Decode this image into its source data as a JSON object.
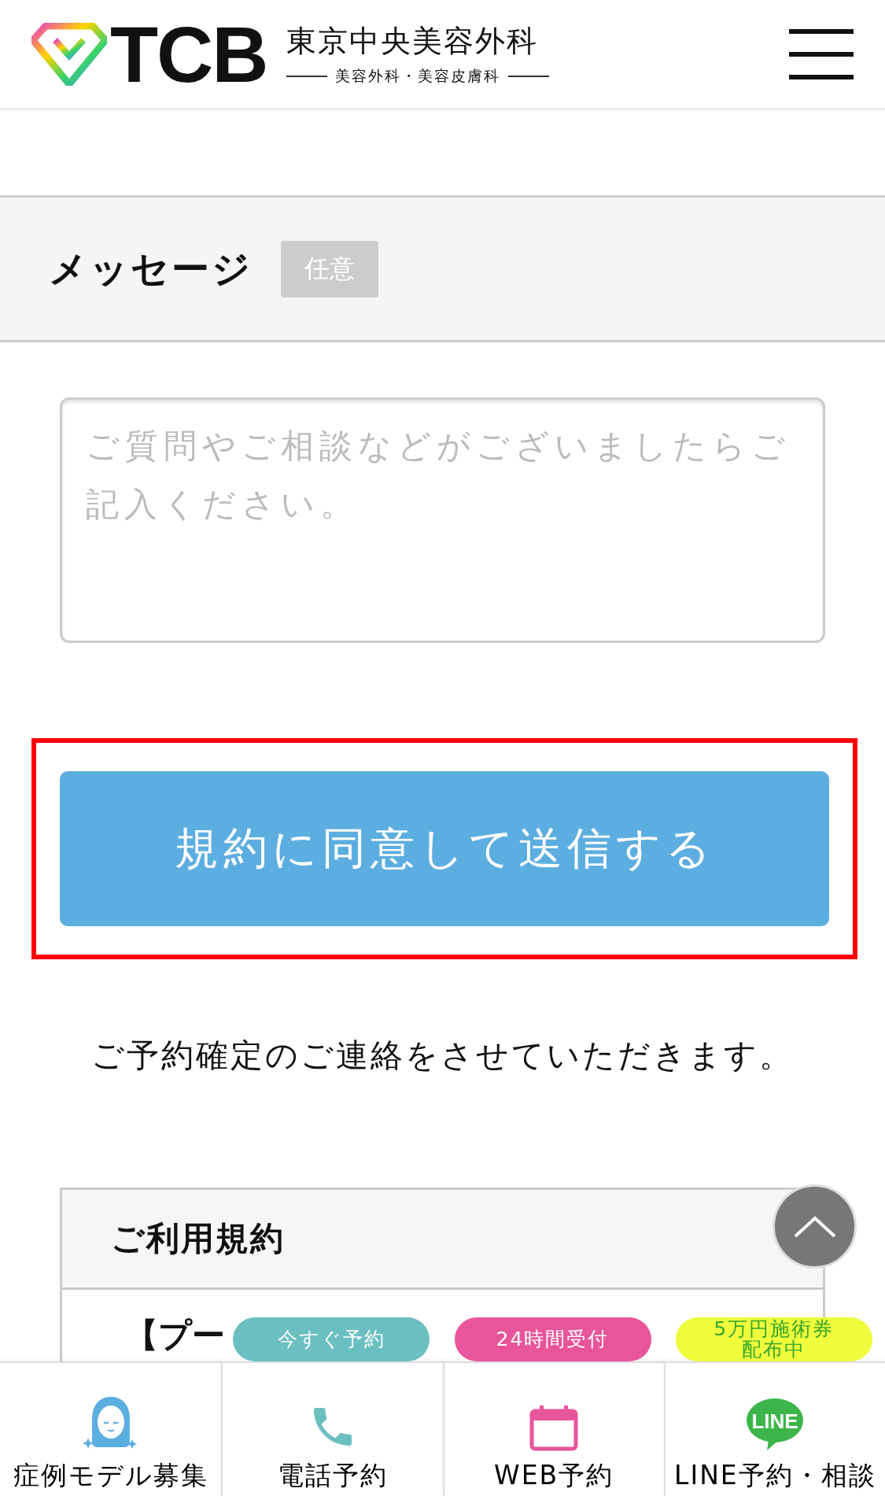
{
  "header": {
    "logo_text": "TCB",
    "clinic_name": "東京中央美容外科",
    "subtitle": "美容外科・美容皮膚科"
  },
  "message_section": {
    "label": "メッセージ",
    "badge": "任意",
    "placeholder": "ご質問やご相談などがございましたらご記入ください。"
  },
  "submit_button": {
    "label": "規約に同意して送信する",
    "highlighted": true
  },
  "note": "ご予約確定のご連絡をさせていただきます。",
  "terms": {
    "title": "ご利用規約",
    "first_line": "【プー"
  },
  "bottom_nav": [
    {
      "kind": "model",
      "label": "症例モデル募集"
    },
    {
      "kind": "phone",
      "label": "電話予約",
      "badge": "今すぐ予約",
      "color": "#6bbfc1"
    },
    {
      "kind": "web",
      "label": "WEB予約",
      "badge": "24時間受付",
      "color": "#e8559a"
    },
    {
      "kind": "line",
      "label": "LINE予約・相談",
      "badge": "5万円施術券配布中",
      "color": "#eefc3c",
      "logo_text": "LINE"
    }
  ]
}
